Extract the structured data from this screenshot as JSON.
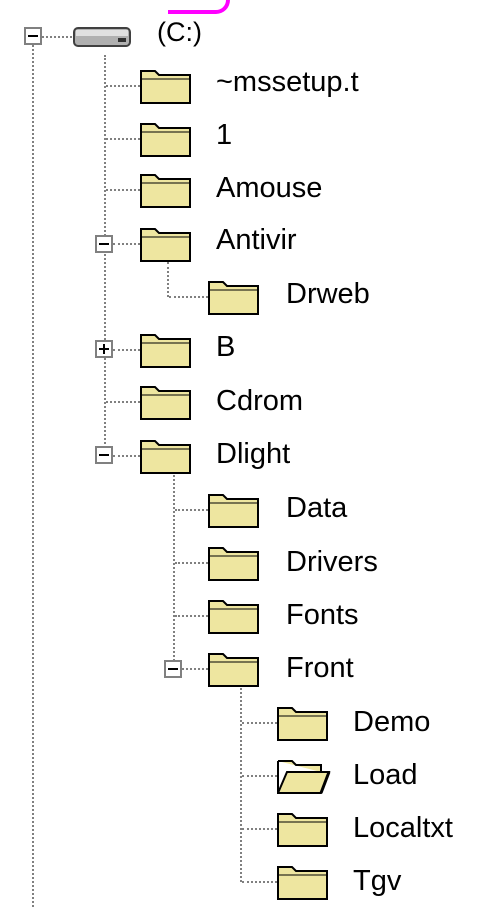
{
  "tree": {
    "drive": {
      "label": "(C:)",
      "icon": "drive-icon",
      "expanded": true
    },
    "items": [
      {
        "label": "~mssetup.t",
        "icon": "folder-icon"
      },
      {
        "label": "1",
        "icon": "folder-icon"
      },
      {
        "label": "Amouse",
        "icon": "folder-icon"
      },
      {
        "label": "Antivir",
        "icon": "folder-icon",
        "expanded": true,
        "children": [
          {
            "label": "Drweb",
            "icon": "folder-icon"
          }
        ]
      },
      {
        "label": "B",
        "icon": "folder-icon",
        "expanded": false
      },
      {
        "label": "Cdrom",
        "icon": "folder-icon"
      },
      {
        "label": "Dlight",
        "icon": "folder-icon",
        "expanded": true,
        "children": [
          {
            "label": "Data",
            "icon": "folder-icon"
          },
          {
            "label": "Drivers",
            "icon": "folder-icon"
          },
          {
            "label": "Fonts",
            "icon": "folder-icon"
          },
          {
            "label": "Front",
            "icon": "folder-icon",
            "expanded": true,
            "children": [
              {
                "label": "Demo",
                "icon": "folder-icon"
              },
              {
                "label": "Load",
                "icon": "open-folder-icon"
              },
              {
                "label": "Localtxt",
                "icon": "folder-icon"
              },
              {
                "label": "Tgv",
                "icon": "folder-icon"
              }
            ]
          }
        ]
      }
    ]
  },
  "colors": {
    "folder_fill": "#eee6a0",
    "folder_outline": "#000000",
    "tree_lines": "#808080",
    "accent_edge": "#ff00ff"
  }
}
